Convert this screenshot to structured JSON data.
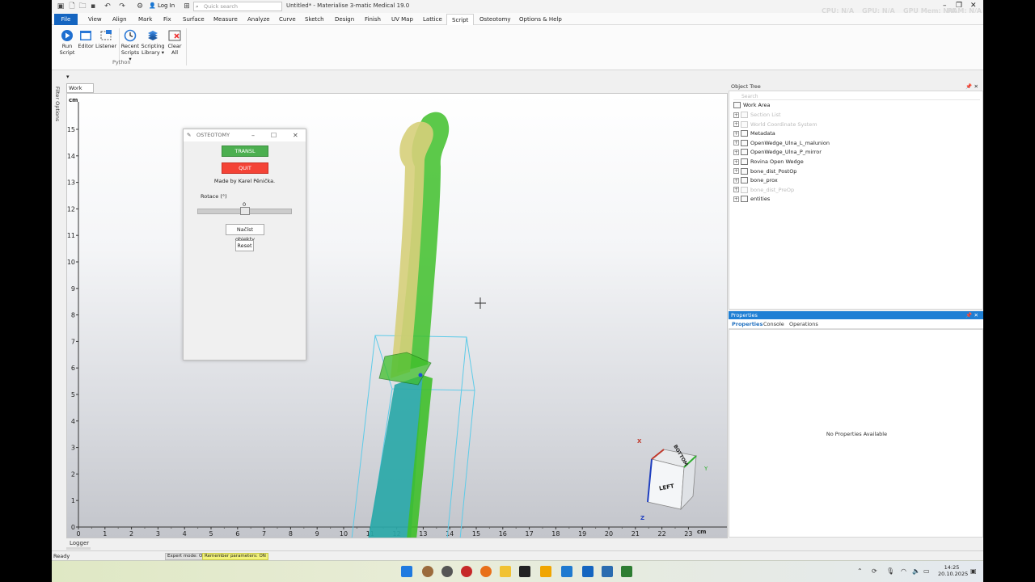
{
  "app": {
    "title": "Untitled* - Materialise 3-matic Medical 19.0",
    "login": "Log In",
    "search_placeholder": "Quick search",
    "perf": [
      "CPU: N/A",
      "GPU: N/A",
      "GPU Mem: N/A",
      "RAM: N/A"
    ]
  },
  "menu": {
    "file": "File",
    "items": [
      "View",
      "Align",
      "Mark",
      "Fix",
      "Surface",
      "Measure",
      "Analyze",
      "Curve",
      "Sketch",
      "Design",
      "Finish",
      "UV Map",
      "Lattice",
      "Script",
      "Osteotomy",
      "Options & Help"
    ],
    "active": "Script"
  },
  "ribbon": {
    "buttons": [
      {
        "line1": "Run",
        "line2": "Script"
      },
      {
        "line1": "Editor",
        "line2": ""
      },
      {
        "line1": "Listener",
        "line2": ""
      },
      {
        "line1": "Recent",
        "line2": "Scripts"
      },
      {
        "line1": "Scripting",
        "line2": "Library"
      },
      {
        "line1": "Clear",
        "line2": "All"
      }
    ],
    "group": "Python"
  },
  "left_strip": {
    "filter_options": "Filter Options"
  },
  "workarea": {
    "tab": "Work Area",
    "unit": "cm",
    "y_ticks": [
      "0",
      "1",
      "2",
      "3",
      "4",
      "5",
      "6",
      "7",
      "8",
      "9",
      "10",
      "11",
      "12",
      "13",
      "14",
      "15"
    ],
    "x_ticks": [
      "0",
      "1",
      "2",
      "3",
      "4",
      "5",
      "6",
      "7",
      "8",
      "9",
      "10",
      "11",
      "12",
      "13",
      "14",
      "15",
      "16",
      "17",
      "18",
      "19",
      "20",
      "21",
      "22",
      "23"
    ],
    "cube": {
      "x": "X",
      "y": "Y",
      "z": "Z",
      "top": "BOTTOM",
      "front": "LEFT"
    }
  },
  "dialog": {
    "title": "OSTEOTOMY",
    "transl": "TRANSL",
    "quit": "QUIT",
    "made_by": "Made by Karel Pěnička.",
    "rot_label": "Rotace (°)",
    "rot_value": "0",
    "rot_fraction": 0.5,
    "load": "Načíst objekty",
    "reset": "Reset",
    "colors": {
      "transl": "#4caf50",
      "quit": "#f44336"
    }
  },
  "object_tree": {
    "title": "Object Tree",
    "search": "Search",
    "root": "Work Area",
    "items": [
      {
        "label": "Section List",
        "dim": true
      },
      {
        "label": "World Coordinate System",
        "dim": true
      },
      {
        "label": "Metadata",
        "dim": false
      },
      {
        "label": "OpenWedge_Ulna_L_malunion",
        "dim": false
      },
      {
        "label": "OpenWedge_Ulna_P_mirror",
        "dim": false
      },
      {
        "label": "Rovina Open Wedge",
        "dim": false
      },
      {
        "label": "bone_dist_PostOp",
        "dim": false
      },
      {
        "label": "bone_prox",
        "dim": false
      },
      {
        "label": "bone_dist_PreOp",
        "dim": true
      },
      {
        "label": "entities",
        "dim": false
      }
    ]
  },
  "properties": {
    "title": "Properties",
    "tabs": [
      "Properties",
      "Console",
      "Operations"
    ],
    "empty": "No Properties Available"
  },
  "bottom": {
    "logger": "Logger",
    "ready": "Ready",
    "expert": "Expert mode: OFF",
    "remember": "Remember parameters: ON"
  },
  "taskbar": {
    "time": "14:25",
    "date": "20.10.2025"
  },
  "colors": {
    "accent": "#1565c0",
    "bone_green": "#3fbf2a",
    "bone_yellow": "#d6cf7a",
    "bone_cyan": "#2aa8a8",
    "wireframe": "#5ecbe8"
  }
}
